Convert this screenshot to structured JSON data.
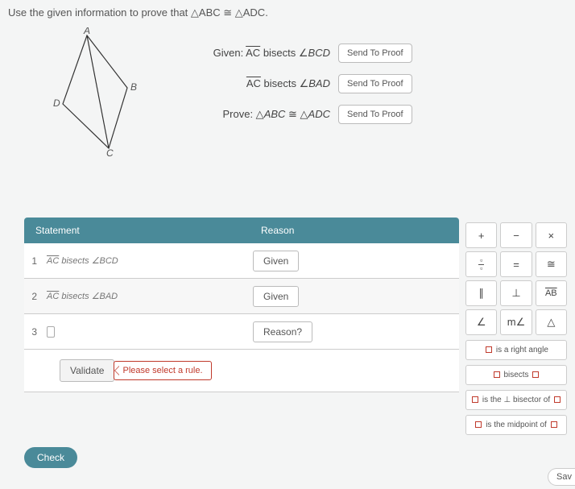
{
  "prompt": "Use the given information to prove that △ABC ≅ △ADC.",
  "diagram": {
    "A": "A",
    "B": "B",
    "C": "C",
    "D": "D"
  },
  "givens": {
    "row1": {
      "label": "Given: AC bisects ∠BCD",
      "btn": "Send To Proof"
    },
    "row2": {
      "label": "AC bisects ∠BAD",
      "btn": "Send To Proof"
    },
    "row3": {
      "label": "Prove: △ABC ≅ △ADC",
      "btn": "Send To Proof"
    }
  },
  "proof": {
    "head_stmt": "Statement",
    "head_rsn": "Reason",
    "rows": [
      {
        "n": "1",
        "stmt": "AC bisects ∠BCD",
        "reason": "Given"
      },
      {
        "n": "2",
        "stmt": "AC bisects ∠BAD",
        "reason": "Given"
      },
      {
        "n": "3",
        "stmt": "",
        "reason": "Reason?"
      }
    ],
    "validate": "Validate",
    "error": "Please select a rule."
  },
  "check": "Check",
  "palette": {
    "g": [
      "+",
      "−",
      "×",
      "frac",
      "=",
      "≅",
      "∥",
      "⊥",
      "AB",
      "∠",
      "m∠",
      "△"
    ],
    "w1": "is a right angle",
    "w2": "bisects",
    "w3": "is the ⊥ bisector of",
    "w4": "is the midpoint of"
  },
  "save": "Sav"
}
